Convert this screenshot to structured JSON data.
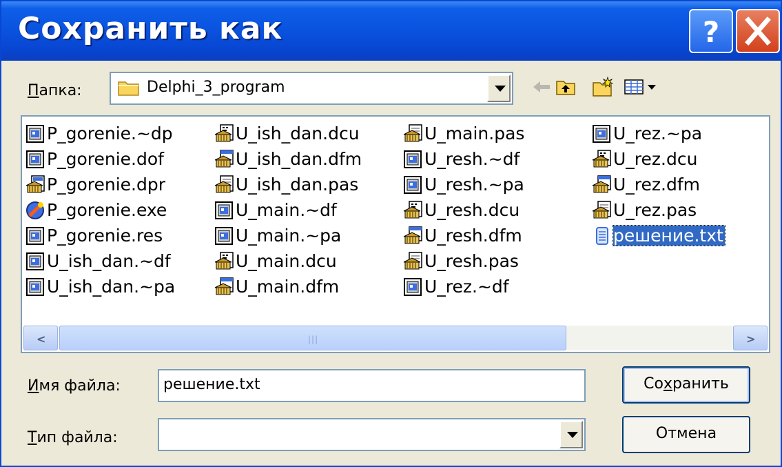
{
  "window": {
    "title": "Сохранить как",
    "help_label": "?",
    "close_label": "X"
  },
  "location": {
    "label_u": "П",
    "label_rest": "апка:",
    "folder": "Delphi_3_program"
  },
  "files": {
    "columns": [
      [
        {
          "name": "P_gorenie.~dp",
          "icon": "form-file-icon"
        },
        {
          "name": "P_gorenie.dof",
          "icon": "form-file-icon"
        },
        {
          "name": "P_gorenie.dpr",
          "icon": "delphi-project-icon"
        },
        {
          "name": "P_gorenie.exe",
          "icon": "executable-icon"
        },
        {
          "name": "P_gorenie.res",
          "icon": "form-file-icon"
        },
        {
          "name": "U_ish_dan.~df",
          "icon": "form-file-icon"
        },
        {
          "name": "U_ish_dan.~pa",
          "icon": "form-file-icon"
        }
      ],
      [
        {
          "name": "U_ish_dan.dcu",
          "icon": "compiled-unit-icon"
        },
        {
          "name": "U_ish_dan.dfm",
          "icon": "delphi-form-icon"
        },
        {
          "name": "U_ish_dan.pas",
          "icon": "pascal-source-icon"
        },
        {
          "name": "U_main.~df",
          "icon": "form-file-icon"
        },
        {
          "name": "U_main.~pa",
          "icon": "form-file-icon"
        },
        {
          "name": "U_main.dcu",
          "icon": "compiled-unit-icon"
        },
        {
          "name": "U_main.dfm",
          "icon": "delphi-form-icon"
        }
      ],
      [
        {
          "name": "U_main.pas",
          "icon": "pascal-source-icon"
        },
        {
          "name": "U_resh.~df",
          "icon": "form-file-icon"
        },
        {
          "name": "U_resh.~pa",
          "icon": "form-file-icon"
        },
        {
          "name": "U_resh.dcu",
          "icon": "compiled-unit-icon"
        },
        {
          "name": "U_resh.dfm",
          "icon": "delphi-form-icon"
        },
        {
          "name": "U_resh.pas",
          "icon": "pascal-source-icon"
        },
        {
          "name": "U_rez.~df",
          "icon": "form-file-icon"
        }
      ],
      [
        {
          "name": "U_rez.~pa",
          "icon": "form-file-icon"
        },
        {
          "name": "U_rez.dcu",
          "icon": "compiled-unit-icon"
        },
        {
          "name": "U_rez.dfm",
          "icon": "delphi-form-icon"
        },
        {
          "name": "U_rez.pas",
          "icon": "pascal-source-icon"
        },
        {
          "name": "решение.txt",
          "icon": "text-file-icon",
          "selected": true
        }
      ]
    ]
  },
  "filename": {
    "label_u": "И",
    "label_rest": "мя файла:",
    "value": "решение.txt"
  },
  "filetype": {
    "label_u": "Т",
    "label_rest": "ип файла:",
    "value": ""
  },
  "buttons": {
    "save_pre": "Со",
    "save_u": "х",
    "save_post": "ранить",
    "cancel": "Отмена"
  }
}
